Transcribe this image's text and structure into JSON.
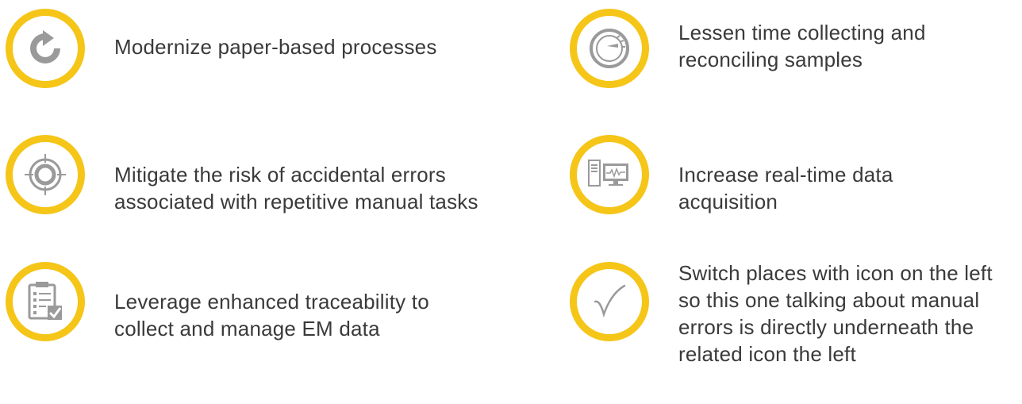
{
  "colors": {
    "ring": "#f5c518",
    "icon": "#9a9a9a",
    "accent": "#8dc63f",
    "text": "#3a3a3a"
  },
  "items": [
    {
      "icon": "refresh-icon",
      "lines": [
        "Modernize paper-based processes"
      ]
    },
    {
      "icon": "speedometer-icon",
      "lines": [
        "Lessen time collecting and",
        "reconciling samples"
      ]
    },
    {
      "icon": "target-icon",
      "lines": [
        "Mitigate the risk of accidental errors",
        "associated with repetitive manual tasks"
      ]
    },
    {
      "icon": "computer-monitor-icon",
      "lines": [
        "Increase real-time data",
        "acquisition"
      ]
    },
    {
      "icon": "checklist-icon",
      "lines": [
        "Leverage enhanced traceability to",
        "collect and manage EM data"
      ]
    },
    {
      "icon": "checkmark-icon",
      "lines": [
        "Switch places with icon on the left",
        "so this one talking about manual",
        "errors is directly underneath the",
        "related icon the left"
      ]
    }
  ]
}
